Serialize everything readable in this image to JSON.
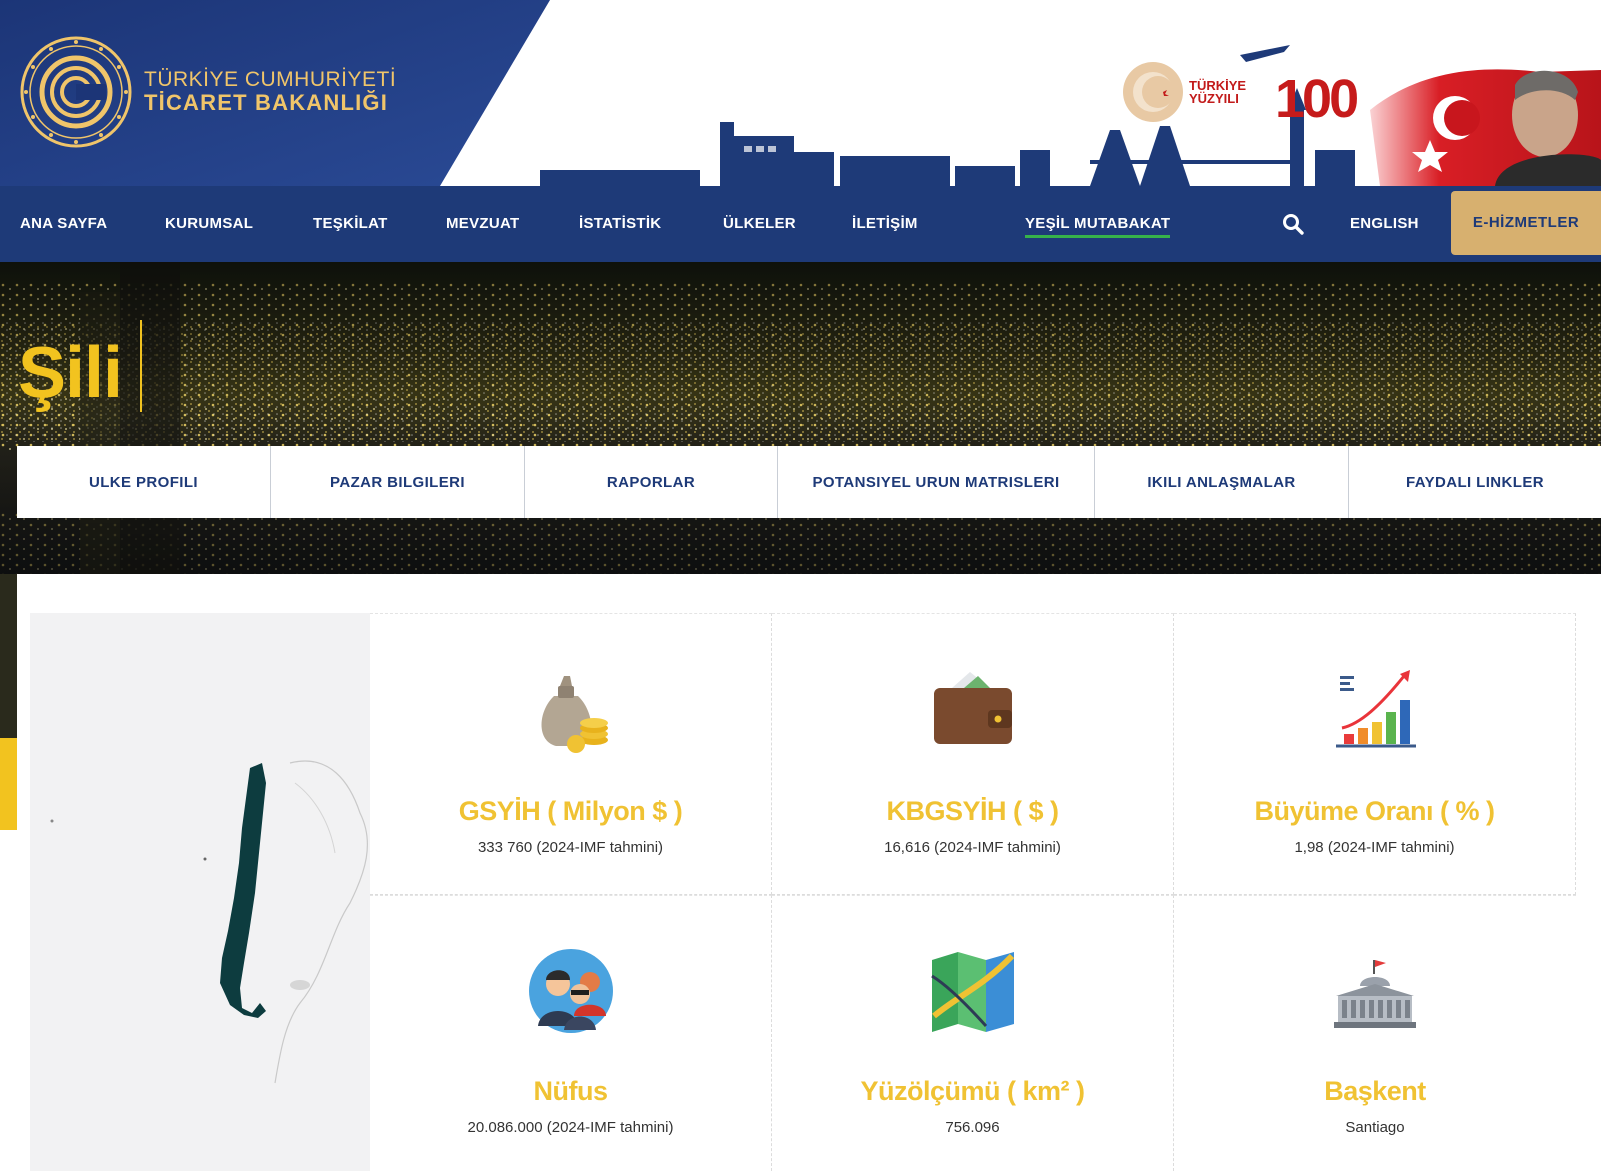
{
  "header": {
    "logo_line1": "TÜRKİYE CUMHURİYETİ",
    "logo_line2": "TİCARET BAKANLIĞI",
    "centennial_line1": "TÜRKİYE",
    "centennial_line2": "YÜZYILI",
    "centennial_number": "100"
  },
  "nav": {
    "items": [
      {
        "label": "ANA SAYFA"
      },
      {
        "label": "KURUMSAL"
      },
      {
        "label": "TEŞKİLAT"
      },
      {
        "label": "MEVZUAT"
      },
      {
        "label": "İSTATİSTİK"
      },
      {
        "label": "ÜLKELER"
      },
      {
        "label": "İLETİŞİM"
      },
      {
        "label": "YEŞİL MUTABAKAT"
      }
    ],
    "english": "ENGLISH",
    "e_hizmetler": "E-HİZMETLER"
  },
  "hero": {
    "title": "Şili"
  },
  "tabs": [
    {
      "label": "ULKE PROFILI"
    },
    {
      "label": "PAZAR BILGILERI"
    },
    {
      "label": "RAPORLAR"
    },
    {
      "label": "POTANSIYEL URUN MATRISLERI"
    },
    {
      "label": "IKILI ANLAŞMALAR"
    },
    {
      "label": "FAYDALI LINKLER"
    }
  ],
  "stats": [
    {
      "icon": "money-bag-icon",
      "title": "GSYİH ( Milyon $ )",
      "value": "333 760 (2024-IMF tahmini)"
    },
    {
      "icon": "wallet-icon",
      "title": "KBGSYİH ( $ )",
      "value": "16,616 (2024-IMF tahmini)"
    },
    {
      "icon": "growth-chart-icon",
      "title": "Büyüme Oranı ( % )",
      "value": "1,98 (2024-IMF tahmini)"
    },
    {
      "icon": "people-icon",
      "title": "Nüfus",
      "value": "20.086.000 (2024-IMF tahmini)"
    },
    {
      "icon": "folded-map-icon",
      "title": "Yüzölçümü ( km² )",
      "value": "756.096"
    },
    {
      "icon": "government-building-icon",
      "title": "Başkent",
      "value": "Santiago"
    }
  ],
  "colors": {
    "navy": "#1e3a78",
    "gold": "#d7b06f",
    "stat_title": "#f0c233",
    "hero_title": "#f2c31f",
    "green_underline": "#36b24a"
  }
}
